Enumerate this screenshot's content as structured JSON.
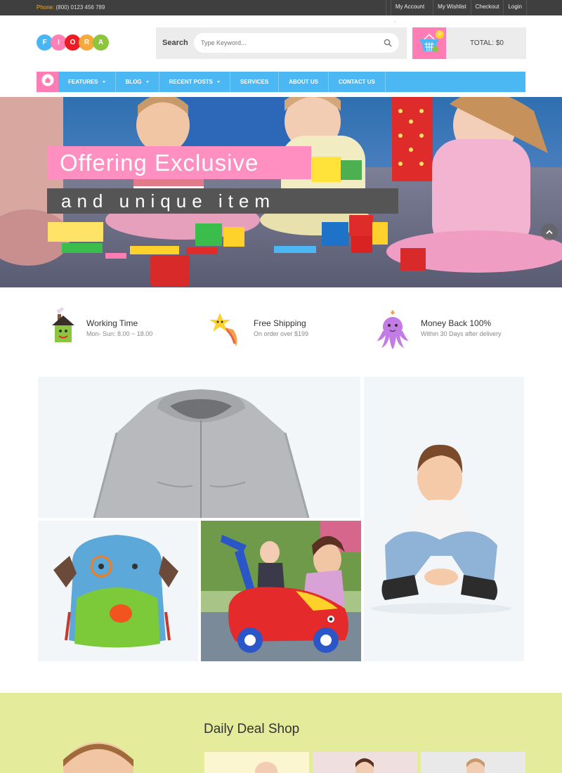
{
  "topbar": {
    "phone_label": "Phone:",
    "phone_number": "(800) 0123 456 789",
    "links": [
      "My Account",
      "My Wishlist",
      "Checkout",
      "Login"
    ]
  },
  "logo": {
    "letters": [
      "F",
      "I",
      "O",
      "R",
      "A"
    ],
    "colors": [
      "#47b6f2",
      "#ff80b5",
      "#ed1b24",
      "#f8a93b",
      "#8cc63f"
    ]
  },
  "search": {
    "label": "Search",
    "placeholder": "Type Keyword..."
  },
  "cart": {
    "count": "0",
    "total": "TOTAL: $0"
  },
  "nav": {
    "items": [
      {
        "label": "FEATURES",
        "dropdown": true
      },
      {
        "label": "BLOG",
        "dropdown": true
      },
      {
        "label": "RECENT POSTS",
        "dropdown": true
      },
      {
        "label": "SERVICES",
        "dropdown": false
      },
      {
        "label": "ABOUT US",
        "dropdown": false
      },
      {
        "label": "CONTACT US",
        "dropdown": false
      }
    ]
  },
  "hero": {
    "headline": "Offering Exclusive",
    "subline": "and unique item"
  },
  "features": [
    {
      "title": "Working Time",
      "subtitle": "Mon- Sun: 8.00 ~ 18.00",
      "icon": "house-icon"
    },
    {
      "title": "Free Shipping",
      "subtitle": "On order over $199",
      "icon": "shooting-star-icon"
    },
    {
      "title": "Money Back 100%",
      "subtitle": "Within 30 Days after delivery",
      "icon": "octopus-icon"
    }
  ],
  "deal": {
    "title": "Daily Deal Shop"
  },
  "colors": {
    "topbar": "#3f3f3f",
    "nav": "#4bb8f4",
    "pink": "#ff7cb4",
    "yellow": "#ffe366",
    "deal_bg": "#e4ec9c"
  }
}
